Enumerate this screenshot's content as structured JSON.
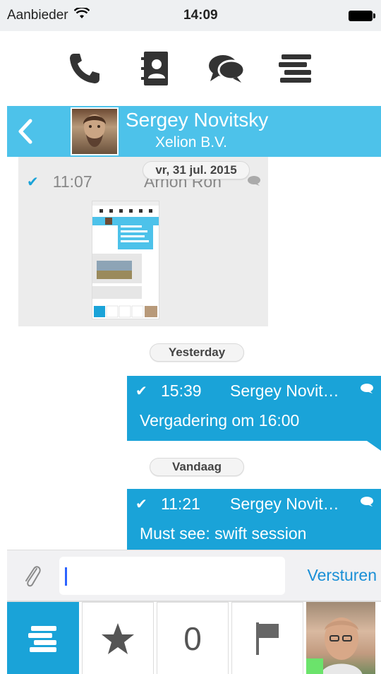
{
  "status_bar": {
    "carrier": "Aanbieder",
    "time": "14:09"
  },
  "top_nav": {
    "items": [
      {
        "icon": "phone-icon"
      },
      {
        "icon": "contacts-book-icon"
      },
      {
        "icon": "chat-bubbles-icon"
      },
      {
        "icon": "list-icon"
      }
    ]
  },
  "contact": {
    "name": "Sergey Novitsky",
    "company": "Xelion B.V."
  },
  "messages": {
    "incoming": {
      "date": "vr, 31 jul. 2015",
      "time": "11:07",
      "sender": "Arnon Ron"
    },
    "separator_yesterday": "Yesterday",
    "outgoing_1": {
      "time": "15:39",
      "sender": "Sergey Novit…",
      "text": "Vergadering om 16:00"
    },
    "separator_today": "Vandaag",
    "outgoing_2": {
      "time": "11:21",
      "sender": "Sergey Novit…",
      "text": "Must see: swift session"
    }
  },
  "input_bar": {
    "value": "",
    "send_label": "Versturen"
  },
  "tab_bar": {
    "count": "0"
  },
  "colors": {
    "accent": "#1aa3d8",
    "header": "#4dc2ea",
    "presence": "#6be36b"
  }
}
